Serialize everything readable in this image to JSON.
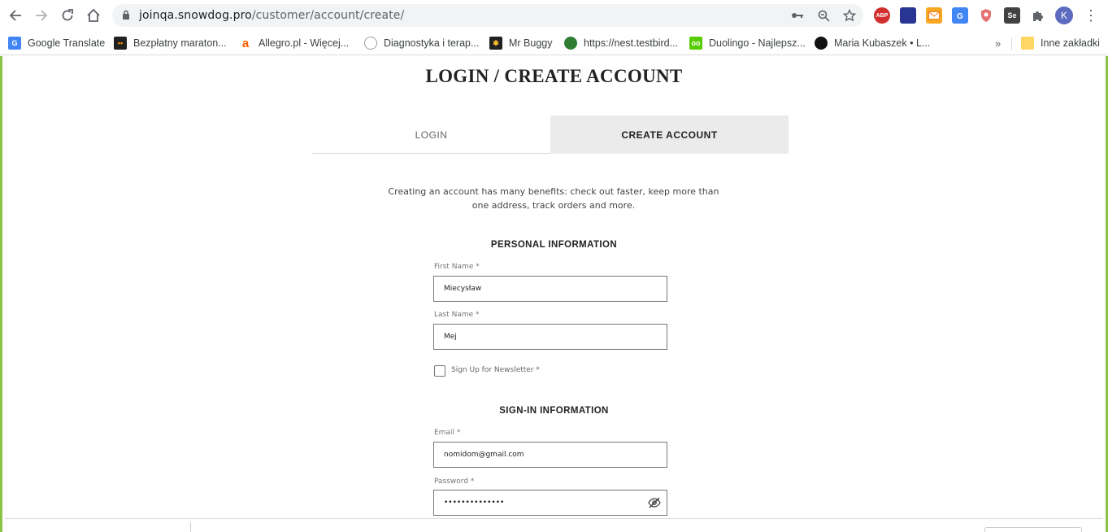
{
  "browser": {
    "url_host": "joinqa.snowdog.pro",
    "url_path": "/customer/account/create/",
    "profile_initial": "K",
    "extensions": [
      {
        "name": "adblock-plus-icon",
        "label": "ABP",
        "color": "#d32f2f"
      },
      {
        "name": "extension-icon-blue",
        "label": "",
        "color": "#283593"
      },
      {
        "name": "email-extension-icon",
        "label": "",
        "color": "#f9a825"
      },
      {
        "name": "translate-extension-icon",
        "label": "",
        "color": "#4285f4"
      },
      {
        "name": "shield-extension-icon",
        "label": "",
        "color": "#e53935"
      },
      {
        "name": "selenium-ide-icon",
        "label": "Se",
        "color": "#424242"
      }
    ]
  },
  "bookmarks": [
    {
      "label": "Google Translate",
      "icon": "google-translate-icon",
      "color": "#4285f4"
    },
    {
      "label": "Bezpłatny maraton...",
      "icon": "maraton-icon",
      "color": "#212121"
    },
    {
      "label": "Allegro.pl - Więcej...",
      "icon": "allegro-icon",
      "color": "#ff5a00"
    },
    {
      "label": "Diagnostyka i terap...",
      "icon": "diagnostyka-icon",
      "color": "#9e9e9e"
    },
    {
      "label": "Mr Buggy",
      "icon": "mr-buggy-icon",
      "color": "#212121"
    },
    {
      "label": "https://nest.testbird...",
      "icon": "testbird-icon",
      "color": "#2e7d32"
    },
    {
      "label": "Duolingo - Najlepsz...",
      "icon": "duolingo-icon",
      "color": "#58cc02"
    },
    {
      "label": "Maria Kubaszek • L...",
      "icon": "maria-kubaszek-icon",
      "color": "#111111"
    }
  ],
  "bookmarks_more": "»",
  "other_bookmarks": "Inne zakładki",
  "page": {
    "title": "LOGIN / CREATE ACCOUNT",
    "tabs": {
      "login": "LOGIN",
      "create": "CREATE ACCOUNT"
    },
    "intro": "Creating an account has many benefits: check out faster, keep more than one address, track orders and more.",
    "personal_title": "PERSONAL INFORMATION",
    "first_name_label": "First Name *",
    "first_name_value": "Miecysław",
    "last_name_label": "Last Name *",
    "last_name_value": "Mej",
    "newsletter_label": "Sign Up for Newsletter *",
    "signin_title": "SIGN-IN INFORMATION",
    "email_label": "Email *",
    "email_value": "nomidom@gmail.com",
    "password_label": "Password *",
    "password_value": "••••••••••••••"
  },
  "colors": {
    "accent_border": "#8bc34a",
    "active_tab": "#ebebeb"
  }
}
